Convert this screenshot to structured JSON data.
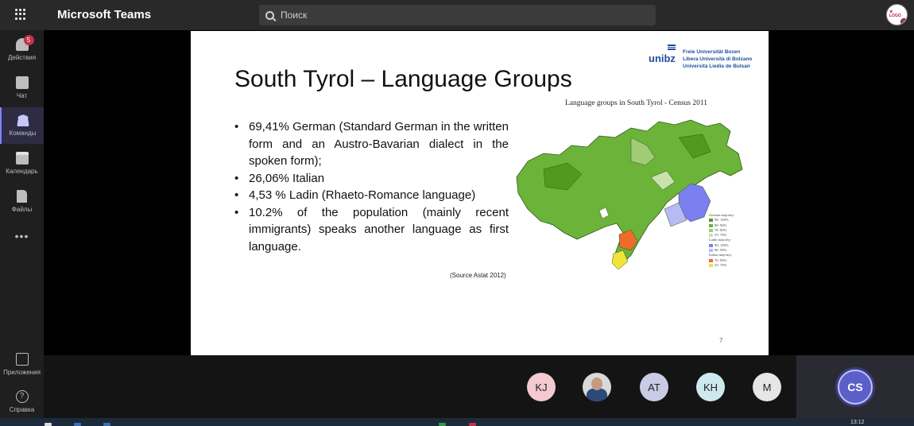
{
  "app": {
    "title": "Microsoft Teams"
  },
  "search": {
    "placeholder": "Поиск"
  },
  "rail": {
    "activity": {
      "label": "Действия",
      "badge": "5"
    },
    "chat": {
      "label": "Чат"
    },
    "teams": {
      "label": "Команды"
    },
    "calendar": {
      "label": "Календарь"
    },
    "files": {
      "label": "Файлы"
    },
    "more": {
      "label": "•••"
    },
    "apps": {
      "label": "Приложения"
    },
    "help": {
      "label": "Справка"
    }
  },
  "slide": {
    "logo": "unibz",
    "university_names": [
      "Freie Universität Bozen",
      "Libera Università di Bolzano",
      "Università Liedia de Bulsan"
    ],
    "title": "South Tyrol – Language Groups",
    "bullets": [
      "69,41% German (Standard German in the written form and an Austro-Bavarian dialect in the spoken form);",
      "26,06% Italian",
      "4,53 % Ladin (Rhaeto-Romance language)",
      "10.2% of the population (mainly recent immigrants) speaks another language as first language."
    ],
    "source": "(Source Astat 2012)",
    "page_number": "7",
    "map": {
      "caption": "Language groups in South Tyrol - Census 2011",
      "legend": {
        "german_heading": "German majority:",
        "german": [
          "90- 100%",
          "80- 90%",
          "70- 80%",
          "55- 70%"
        ],
        "ladin_heading": "Ladin majority:",
        "ladin": [
          "90- 100%",
          "80- 90%"
        ],
        "italian_heading": "Italian majority:",
        "italian": [
          "70- 80%",
          "55- 70%"
        ]
      },
      "colors": {
        "german_90": "#4f9a1f",
        "german_80": "#6cb33a",
        "german_70": "#9fcc74",
        "german_55": "#c9e2ad",
        "ladin_90": "#7b7ff0",
        "ladin_80": "#b8baf6",
        "italian_70": "#f06a2a",
        "italian_55": "#f2e33a"
      }
    }
  },
  "participants": [
    {
      "initials": "KJ",
      "color": "#f4c9d0"
    },
    {
      "initials": "",
      "color": "#d9d9d9",
      "photo": true
    },
    {
      "initials": "AT",
      "color": "#c9cbe6"
    },
    {
      "initials": "KH",
      "color": "#cde9ee"
    },
    {
      "initials": "M",
      "color": "#e6e6e6"
    }
  ],
  "self": {
    "initials": "CS"
  },
  "taskbar": {
    "time": "13:12"
  }
}
